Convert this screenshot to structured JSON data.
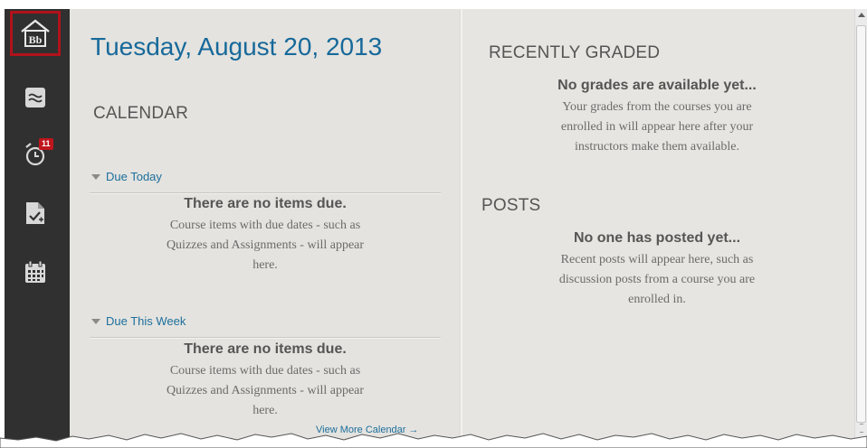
{
  "sidebar": {
    "items": [
      {
        "name": "home",
        "icon": "bb-home-icon"
      },
      {
        "name": "streams",
        "icon": "waves-icon"
      },
      {
        "name": "due-dates",
        "icon": "alarm-clock-icon",
        "badge": "11"
      },
      {
        "name": "grades",
        "icon": "graded-document-icon"
      },
      {
        "name": "calendar",
        "icon": "calendar-icon"
      }
    ],
    "home_logo_text": "Bb"
  },
  "left": {
    "date_title": "Tuesday, August 20, 2013",
    "calendar_heading": "CALENDAR",
    "groups": [
      {
        "toggle_label": "Due Today",
        "empty_title": "There are no items due.",
        "empty_desc_lines": [
          "Course items with due dates - such as",
          "Quizzes and Assignments - will appear",
          "here."
        ]
      },
      {
        "toggle_label": "Due This Week",
        "empty_title": "There are no items due.",
        "empty_desc_lines": [
          "Course items with due dates - such as",
          "Quizzes and Assignments - will appear",
          "here."
        ]
      }
    ],
    "view_more": "View More Calendar →"
  },
  "right": {
    "graded_heading": "RECENTLY GRADED",
    "graded_empty_title": "No grades are available yet...",
    "graded_desc_lines": [
      "Your grades from the courses you are",
      "enrolled in will appear here after your",
      "instructors make them available."
    ],
    "posts_heading": "POSTS",
    "posts_empty_title": "No one has posted yet...",
    "posts_desc_lines": [
      "Recent posts will appear here, such as",
      "discussion posts from a course you are",
      "enrolled in."
    ]
  },
  "colors": {
    "title_blue": "#17699a",
    "link_blue": "#1d6f9c",
    "sidebar_bg": "#303030",
    "active_border": "#b0121b",
    "badge_red": "#c0151d"
  }
}
